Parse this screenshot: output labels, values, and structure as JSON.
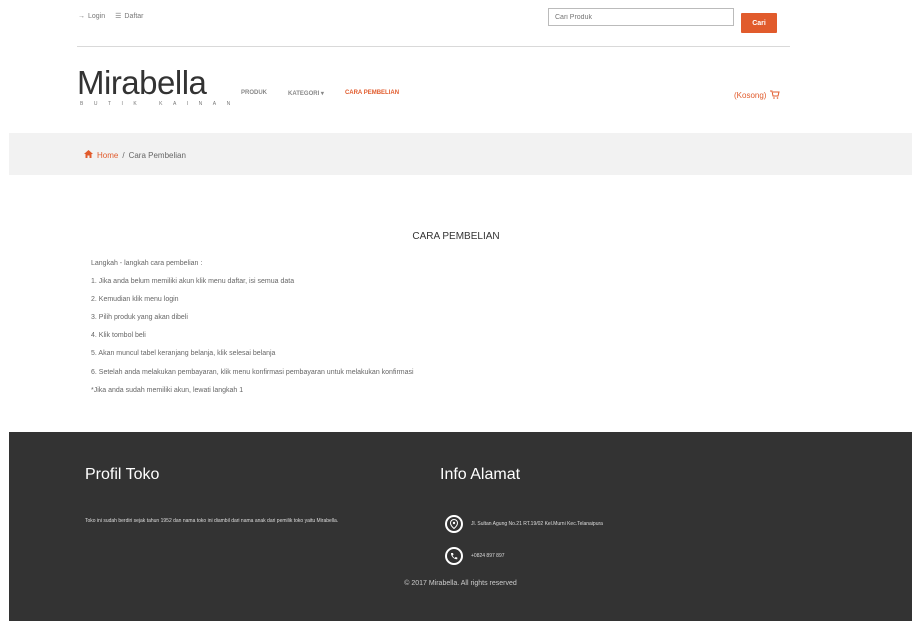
{
  "topbar": {
    "login_label": "Login",
    "daftar_label": "Daftar",
    "search_placeholder": "Cari Produk",
    "search_button": "Cari"
  },
  "header": {
    "logo": "Mirabella",
    "logo_sub": "BUTIK KAINAN",
    "nav": [
      "PRODUK",
      "KATEGORI",
      "CARA PEMBELIAN"
    ],
    "active_nav": "CARA PEMBELIAN",
    "cart_label": "(Kosong)"
  },
  "breadcrumb": {
    "home": "Home",
    "separator": "/",
    "current": "Cara Pembelian"
  },
  "content": {
    "title": "CARA PEMBELIAN",
    "steps": [
      "Langkah - langkah cara pembelian :",
      "1. Jika anda belum memiliki akun klik menu daftar, isi semua data",
      "2. Kemudian klik menu login",
      "3. Pilih produk yang akan dibeli",
      "4. Klik tombol beli",
      "5. Akan muncul tabel keranjang belanja, klik selesai belanja",
      "6. Setelah anda melakukan pembayaran, klik menu konfirmasi pembayaran untuk melakukan konfirmasi",
      "*Jika anda sudah memiliki akun, lewati langkah 1"
    ]
  },
  "footer": {
    "profil_title": "Profil Toko",
    "profil_desc": "Toko ini sudah berdiri sejak tahun 1952 dan nama toko ini diambil dari nama anak dari pemilik toko yaitu Mirabella.",
    "alamat_title": "Info Alamat",
    "address": "Jl. Sultan Agung No.21 RT.19/02 Kel.Murni Kec.Telanaipura",
    "phone": "+0824 897 897",
    "copyright": "© 2017 Mirabella. All rights reserved"
  },
  "colors": {
    "accent": "#e15b2c",
    "footer_bg": "#333333",
    "breadcrumb_bg": "#f2f2f2"
  }
}
